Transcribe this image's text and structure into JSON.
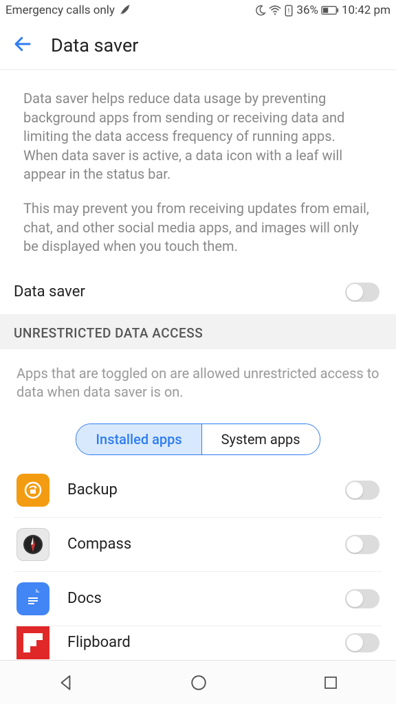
{
  "statusbar": {
    "network": "Emergency calls only",
    "battery_pct": "36%",
    "time": "10:42 pm"
  },
  "header": {
    "title": "Data saver"
  },
  "description": {
    "p1": "Data saver helps reduce data usage by preventing background apps from sending or receiving data and limiting the data access frequency of running apps. When data saver is active, a data icon with a leaf will appear in the status bar.",
    "p2": "This may prevent you from receiving updates from email, chat, and other social media apps, and images will only be displayed when you touch them."
  },
  "main_toggle": {
    "label": "Data saver"
  },
  "section": {
    "header": "UNRESTRICTED DATA ACCESS",
    "desc": "Apps that are toggled on are allowed unrestricted access to data when data saver is on."
  },
  "tabs": {
    "installed": "Installed apps",
    "system": "System apps"
  },
  "apps": [
    {
      "name": "Backup"
    },
    {
      "name": "Compass"
    },
    {
      "name": "Docs"
    },
    {
      "name": "Flipboard"
    }
  ]
}
